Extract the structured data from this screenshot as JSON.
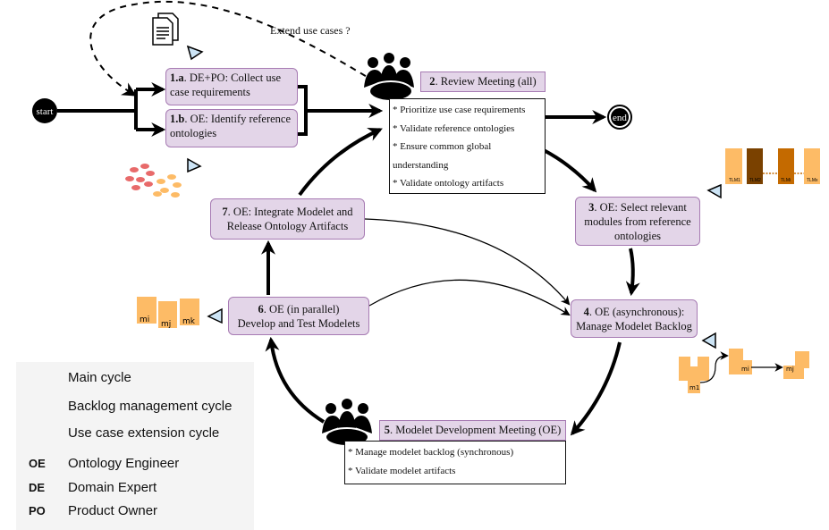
{
  "start_label": "start",
  "end_label": "end",
  "extend_label": "Extend use cases ?",
  "step1a": {
    "num": "1.a",
    "text": ". DE+PO: Collect use case requirements"
  },
  "step1b": {
    "num": "1.b",
    "text": ". OE: Identify reference ontologies"
  },
  "step2": {
    "num": "2",
    "text": ". Review Meeting (all)",
    "items": [
      "* Prioritize use case requirements",
      "* Validate reference ontologies",
      "* Ensure common global",
      "understanding",
      "* Validate ontology artifacts"
    ]
  },
  "step3": {
    "num": "3",
    "text": ". OE: Select relevant modules from reference ontologies"
  },
  "step4": {
    "num": "4",
    "text": ". OE (asynchronous):",
    "text2": "Manage Modelet Backlog"
  },
  "step5": {
    "num": "5",
    "text": ". Modelet Development Meeting (OE)",
    "items": [
      "* Manage modelet backlog (synchronous)",
      "* Validate modelet artifacts"
    ]
  },
  "step6": {
    "num": "6",
    "text": ". OE (in parallel)",
    "text2": "Develop and Test Modelets"
  },
  "step7": {
    "num": "7",
    "text": ". OE: Integrate Modelet and Release Ontology Artifacts"
  },
  "tlm_labels": [
    "TLM1",
    "TLM2",
    "TLMi",
    "TLMx"
  ],
  "modelets_left": [
    "mi",
    "mj",
    "mk"
  ],
  "modelets_right": [
    "m1",
    "mi",
    "mj"
  ],
  "legend": {
    "main": "Main cycle",
    "backlog": "Backlog management cycle",
    "extension": "Use case extension cycle",
    "roles": [
      {
        "abbr": "OE",
        "name": "Ontology Engineer"
      },
      {
        "abbr": "DE",
        "name": "Domain Expert"
      },
      {
        "abbr": "PO",
        "name": "Product Owner"
      }
    ]
  },
  "colors": {
    "box_fill": "#e3d5e8",
    "box_border": "#a77bb3",
    "artifact": "#fdbb66",
    "triangle": "#cce4f5"
  }
}
